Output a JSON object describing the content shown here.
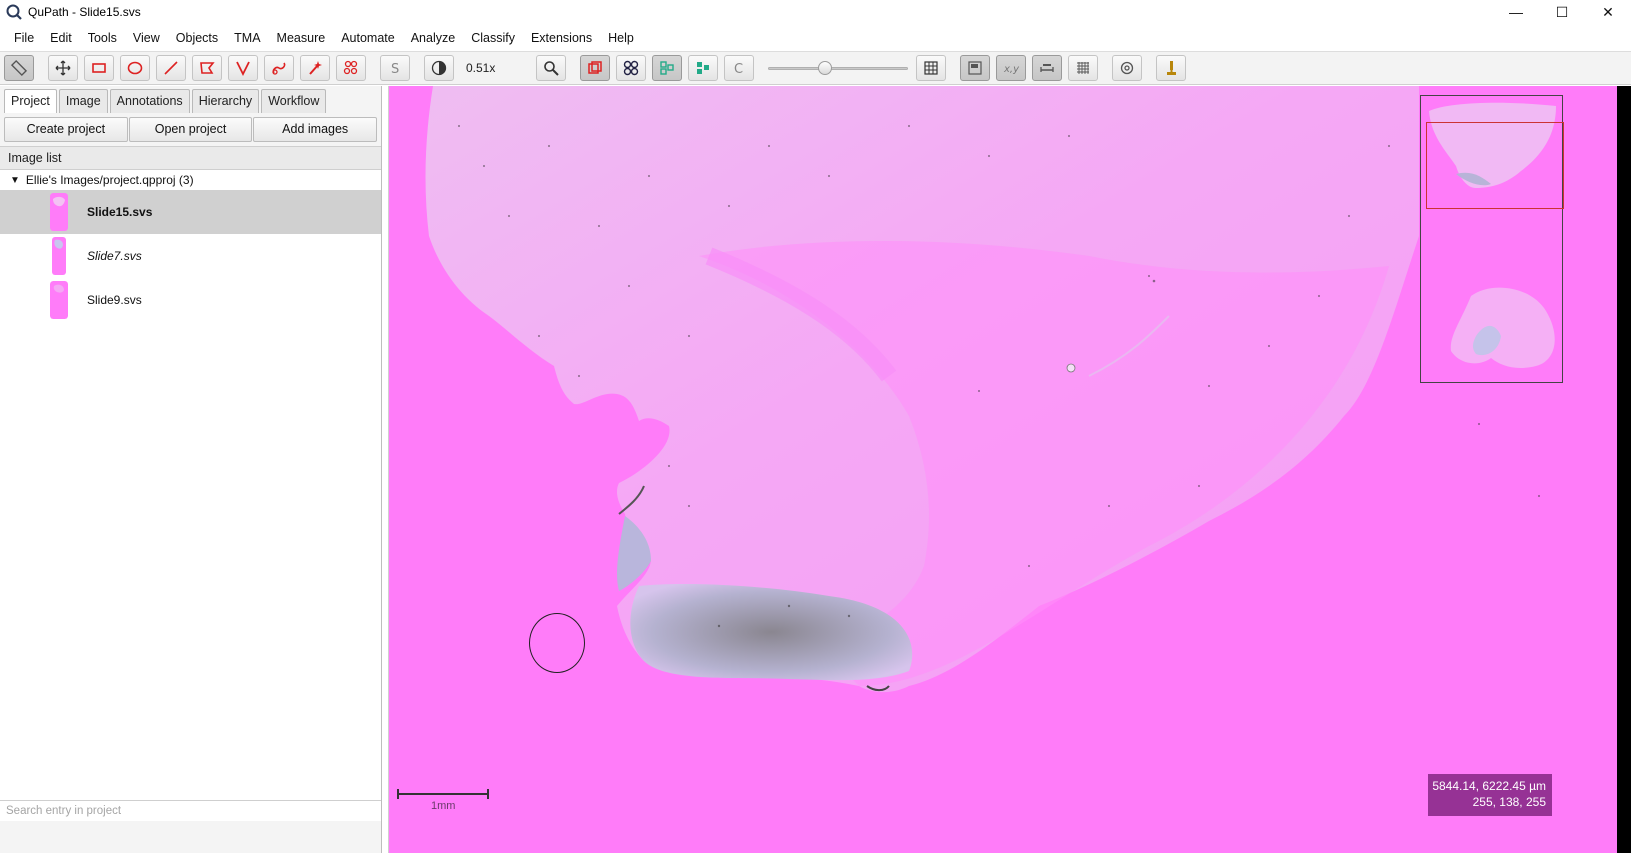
{
  "window": {
    "title": "QuPath - Slide15.svs",
    "controls": {
      "minimize": "—",
      "maximize": "☐",
      "close": "✕"
    }
  },
  "menu": [
    "File",
    "Edit",
    "Tools",
    "View",
    "Objects",
    "TMA",
    "Measure",
    "Automate",
    "Analyze",
    "Classify",
    "Extensions",
    "Help"
  ],
  "toolbar": {
    "zoom": "0.51x"
  },
  "left_panel": {
    "tabs": [
      "Project",
      "Image",
      "Annotations",
      "Hierarchy",
      "Workflow"
    ],
    "active_tab": "Project",
    "buttons": {
      "create": "Create project",
      "open": "Open project",
      "add": "Add images"
    },
    "image_list_header": "Image list",
    "project_root": "Ellie's Images/project.qpproj (3)",
    "images": [
      {
        "name": "Slide15.svs",
        "selected": true
      },
      {
        "name": "Slide7.svs",
        "selected": false
      },
      {
        "name": "Slide9.svs",
        "selected": false
      }
    ],
    "search_placeholder": "Search entry in project"
  },
  "viewer": {
    "scale_label": "1mm",
    "coords_line1": "5844.14, 6222.45 µm",
    "coords_line2": "255, 138, 255",
    "background_color": "#ff7cf9"
  }
}
